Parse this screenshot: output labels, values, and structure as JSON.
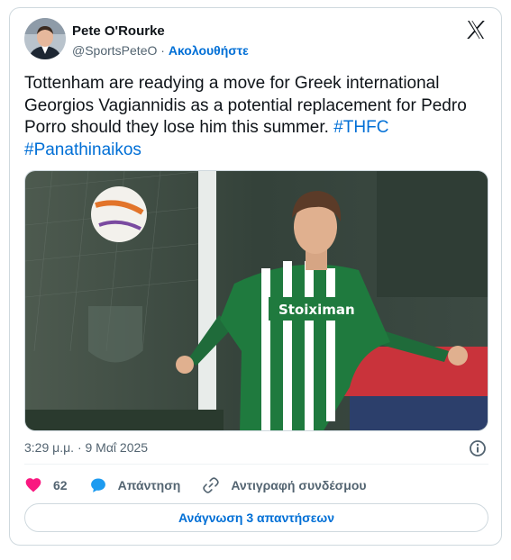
{
  "author": {
    "name": "Pete O'Rourke",
    "handle": "@SportsPeteO",
    "separator": "·",
    "follow_label": "Ακολουθήστε"
  },
  "tweet": {
    "text": "Tottenham are readying a move for Greek international Georgios Vagiannidis as a potential replacement for Pedro Porro should they lose him this summer.",
    "hashtags": [
      "#THFC",
      "#Panathinaikos"
    ]
  },
  "media": {
    "shirt_sponsor": "Stoiximan"
  },
  "meta": {
    "timestamp": "3:29 μ.μ. · 9 Μαΐ 2025"
  },
  "actions": {
    "likes_count": "62",
    "reply_label": "Απάντηση",
    "copy_link_label": "Αντιγραφή συνδέσμου"
  },
  "read_replies_label": "Ανάγνωση 3 απαντήσεων",
  "colors": {
    "accent": "#006fd6",
    "like": "#f91880",
    "reply_icon": "#1d9bf0",
    "muted": "#536471"
  },
  "icons": [
    "x-logo-icon",
    "info-icon",
    "heart-icon",
    "reply-bubble-icon",
    "link-icon"
  ]
}
